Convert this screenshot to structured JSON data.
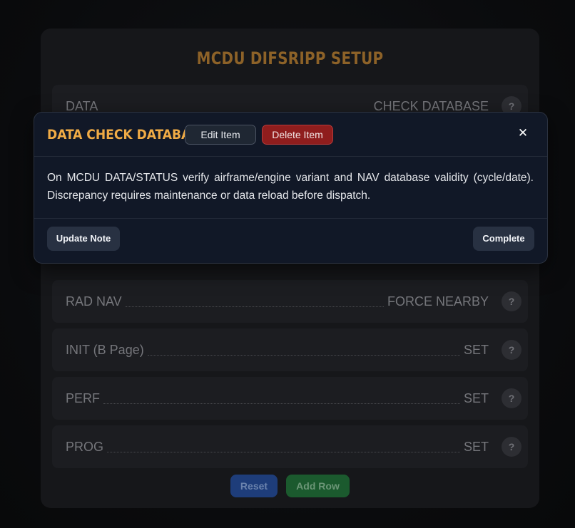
{
  "card": {
    "title": "MCDU DIFSRIPP SETUP",
    "rows": [
      {
        "label": "DATA",
        "value": "CHECK DATABASE",
        "help": "?"
      },
      {
        "label": "RAD NAV",
        "value": "FORCE NEARBY",
        "help": "?"
      },
      {
        "label": "INIT (B Page)",
        "value": "SET",
        "help": "?"
      },
      {
        "label": "PERF",
        "value": "SET",
        "help": "?"
      },
      {
        "label": "PROG",
        "value": "SET",
        "help": "?"
      }
    ],
    "reset_label": "Reset",
    "add_row_label": "Add Row"
  },
  "modal": {
    "title": "DATA CHECK DATABASE",
    "edit_label": "Edit Item",
    "delete_label": "Delete Item",
    "close_glyph": "✕",
    "body": "On MCDU DATA/STATUS verify airframe/engine variant and NAV database validity (cycle/date). Discrepancy requires maintenance or data reload before dispatch.",
    "update_label": "Update Note",
    "complete_label": "Complete"
  },
  "colors": {
    "accent_orange": "#f0ab45",
    "delete_red": "#8f1d1d",
    "reset_blue": "#1e3d7a",
    "add_green": "#1b5a2e"
  }
}
